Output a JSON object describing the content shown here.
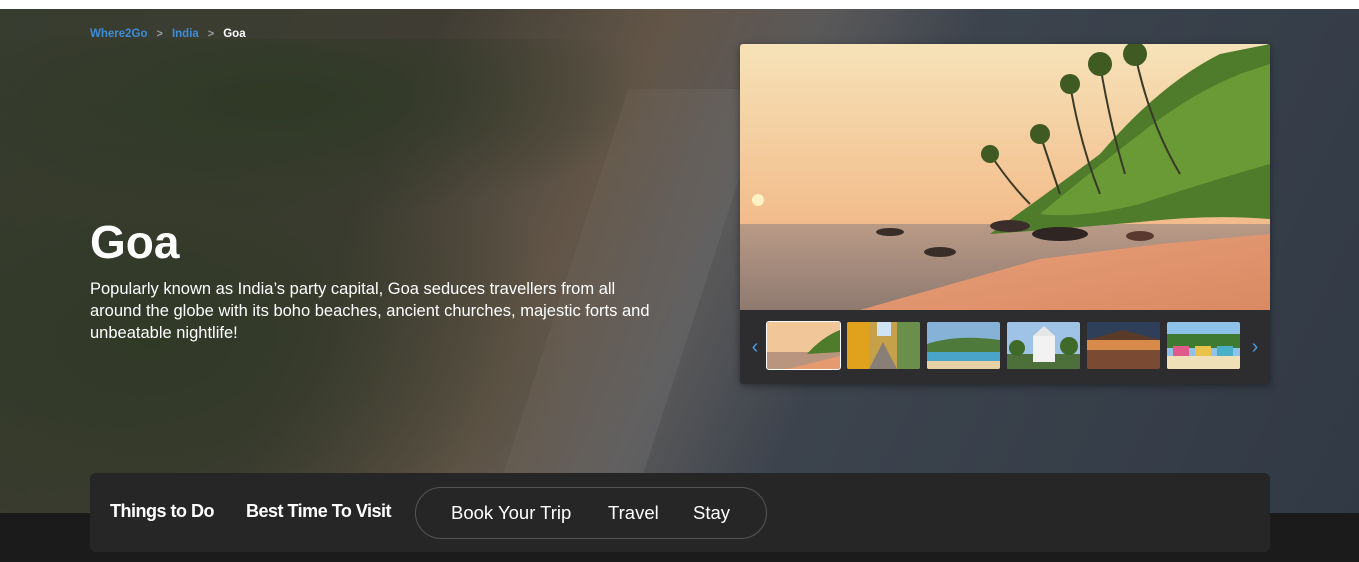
{
  "breadcrumb": {
    "items": [
      {
        "label": "Where2Go"
      },
      {
        "label": "India"
      },
      {
        "label": "Goa"
      }
    ],
    "separator": ">"
  },
  "destination": {
    "title": "Goa",
    "description": "Popularly known as India’s party capital, Goa seduces travellers from all around the globe with its boho beaches, ancient churches, majestic forts and unbeatable nightlife!"
  },
  "gallery": {
    "prev_icon": "‹",
    "next_icon": "›",
    "thumbnails": [
      {
        "subject": "beach-sunset",
        "selected": true
      },
      {
        "subject": "colorful-street",
        "selected": false
      },
      {
        "subject": "beach-coastline",
        "selected": false
      },
      {
        "subject": "white-church",
        "selected": false
      },
      {
        "subject": "beach-restaurant",
        "selected": false
      },
      {
        "subject": "beach-huts",
        "selected": false
      }
    ]
  },
  "nav": {
    "things_to_do": "Things to Do",
    "best_time": "Best Time To Visit",
    "book_trip": "Book Your Trip",
    "travel": "Travel",
    "stay": "Stay"
  },
  "colors": {
    "link": "#3d8dd6",
    "arrow": "#4a9be0",
    "nav_bg": "#262626",
    "page_bg": "#1b1b1b"
  }
}
